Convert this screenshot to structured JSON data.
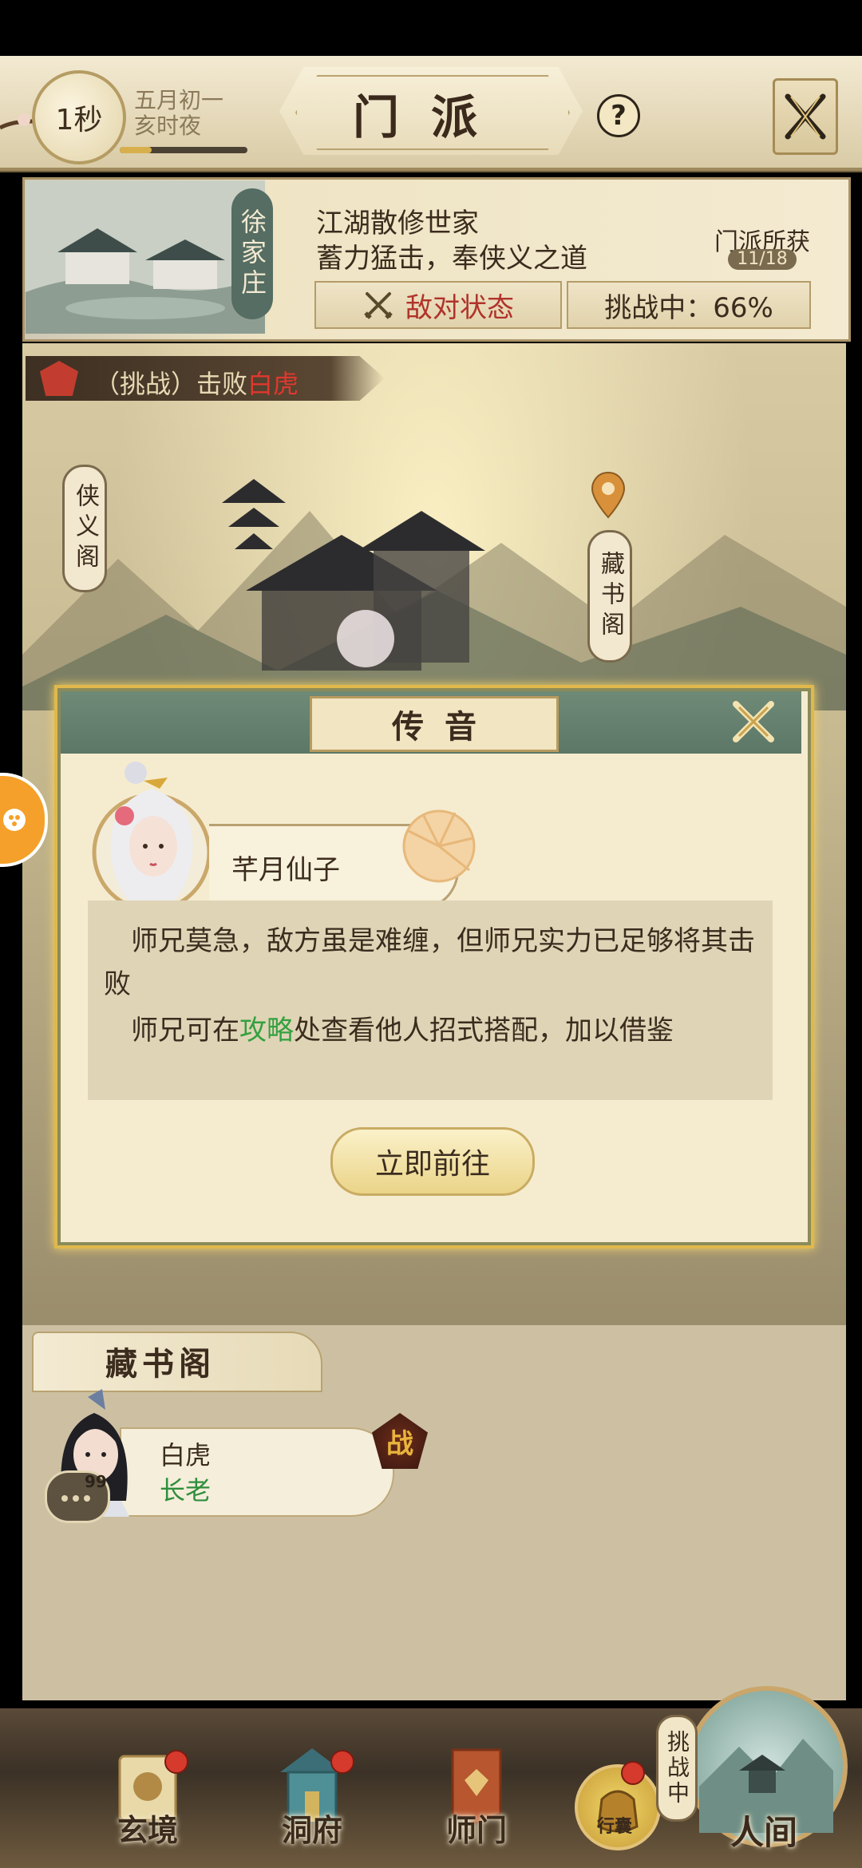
{
  "header": {
    "timer": "1秒",
    "date_line1": "五月初一",
    "date_line2": "亥时夜",
    "title": "门派",
    "help_symbol": "?"
  },
  "sect": {
    "name": "徐家庄",
    "line1": "江湖散修世家",
    "line2": "蓄力猛击，奉侠义之道",
    "gain_label": "门派所获",
    "gain_count": "11/18",
    "hostile_label": "敌对状态",
    "challenge_status": "挑战中：66%",
    "challenge_progress": 0.66
  },
  "task": {
    "prefix": "（挑战）击败",
    "target": "白虎",
    "target_color": "#e0382e"
  },
  "map": {
    "tag_left": "侠义阁",
    "tag_right": "藏书阁"
  },
  "dialog": {
    "title": "传音",
    "speaker": "芊月仙子",
    "message1": "师兄莫急，敌方虽是难缠，但师兄实力已足够将其击败",
    "message2_before": "师兄可在",
    "message2_link": "攻略",
    "message2_after": "处查看他人招式搭配，加以借鉴",
    "link_color": "#33a13f",
    "go_button": "立即前往"
  },
  "library": {
    "title": "藏书阁",
    "member_name": "白虎",
    "member_role": "长老",
    "member_level": "99",
    "fight_glyph": "战"
  },
  "bottom_nav": {
    "items": [
      "玄境",
      "洞府",
      "师门"
    ],
    "bag_label": "行囊",
    "challenge_tag": "挑战中",
    "world_label": "人间"
  },
  "colors": {
    "accent_gold": "#e0b84b",
    "hostile_red": "#b0332b",
    "elder_green": "#2f8e3c"
  }
}
